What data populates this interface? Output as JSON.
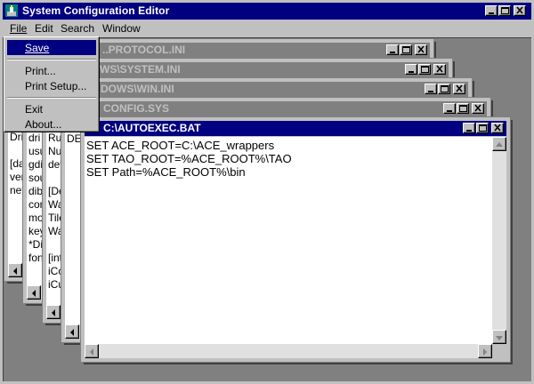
{
  "app": {
    "title": "System Configuration Editor"
  },
  "menubar": {
    "file": "File",
    "edit": "Edit",
    "search": "Search",
    "window": "Window"
  },
  "file_menu": {
    "save": "Save",
    "print": "Print...",
    "print_setup": "Print Setup...",
    "exit": "Exit",
    "about": "About..."
  },
  "windows": {
    "protocol": {
      "title": "..PROTOCOL.INI"
    },
    "system": {
      "title": "WS\\SYSTEM.INI"
    },
    "win": {
      "title": "DOWS\\WIN.INI"
    },
    "config": {
      "title": "CONFIG.SYS"
    },
    "autoexec": {
      "title": "C:\\AUTOEXEC.BAT",
      "lines": [
        "SET ACE_ROOT=C:\\ACE_wrappers",
        "SET TAO_ROOT=%ACE_ROOT%\\TAO",
        "SET Path=%ACE_ROOT%\\bin"
      ]
    }
  },
  "peek": {
    "protocol_text": "Dri\n\n[da\nver\nnet",
    "system_text": "dri\nusu\ngdi\nsou\ndib\ncom\nmo\nkey\n*Di\nfon",
    "win_text": "Ru\nNu\ndev\n\n[De\nWa\nTile\nWa\n\n[int\niCo\niCu",
    "config_text": "DE"
  }
}
